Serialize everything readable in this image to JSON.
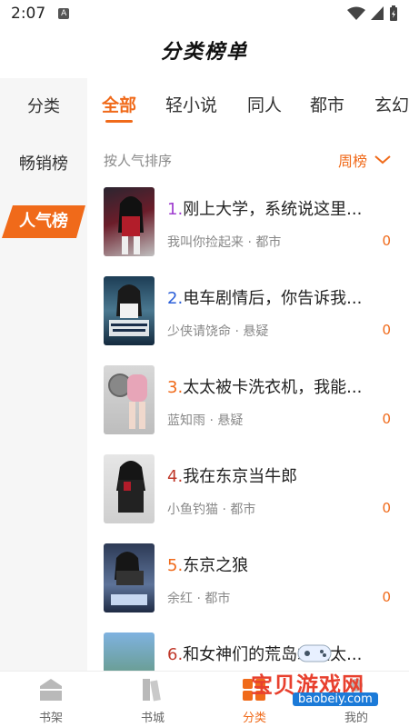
{
  "status_bar": {
    "time": "2:07",
    "notification_icon": "A"
  },
  "title": "分类榜单",
  "sidebar": {
    "items": [
      {
        "label": "分类"
      },
      {
        "label": "畅销榜"
      },
      {
        "label": "人气榜",
        "active": true
      }
    ]
  },
  "tabs": [
    {
      "label": "全部",
      "active": true
    },
    {
      "label": "轻小说"
    },
    {
      "label": "同人"
    },
    {
      "label": "都市"
    },
    {
      "label": "玄幻"
    }
  ],
  "sort": {
    "label": "按人气排序",
    "period": "周榜"
  },
  "books": [
    {
      "rank": "1.",
      "title": "刚上大学，系统说这里...",
      "meta": "我叫你捡起来 · 都市",
      "count": "0",
      "rank_color": "#a03fd0"
    },
    {
      "rank": "2.",
      "title": "电车剧情后，你告诉我...",
      "meta": "少侠请饶命 · 悬疑",
      "count": "0",
      "rank_color": "#2b5fd8"
    },
    {
      "rank": "3.",
      "title": "太太被卡洗衣机，我能...",
      "meta": "蓝知雨 · 悬疑",
      "count": "0",
      "rank_color": "#f06a1a"
    },
    {
      "rank": "4.",
      "title": "我在东京当牛郎",
      "meta": "小鱼钓猫 · 都市",
      "count": "0",
      "rank_color": "#c0392b"
    },
    {
      "rank": "5.",
      "title": "东京之狼",
      "meta": "余红 · 都市",
      "count": "0",
      "rank_color": "#f06a1a"
    },
    {
      "rank": "6.",
      "title": "和女神们的荒岛求生太...",
      "meta": "",
      "count": "",
      "rank_color": "#c0392b"
    }
  ],
  "bottom_nav": [
    {
      "label": "书架",
      "icon": "bookshelf-icon"
    },
    {
      "label": "书城",
      "icon": "bookstore-icon"
    },
    {
      "label": "分类",
      "icon": "category-icon",
      "active": true
    },
    {
      "label": "我的",
      "icon": "profile-icon"
    }
  ],
  "watermark": {
    "text": "宝贝游戏网",
    "url": "baobeiy.com"
  },
  "colors": {
    "accent": "#f06a1a"
  }
}
